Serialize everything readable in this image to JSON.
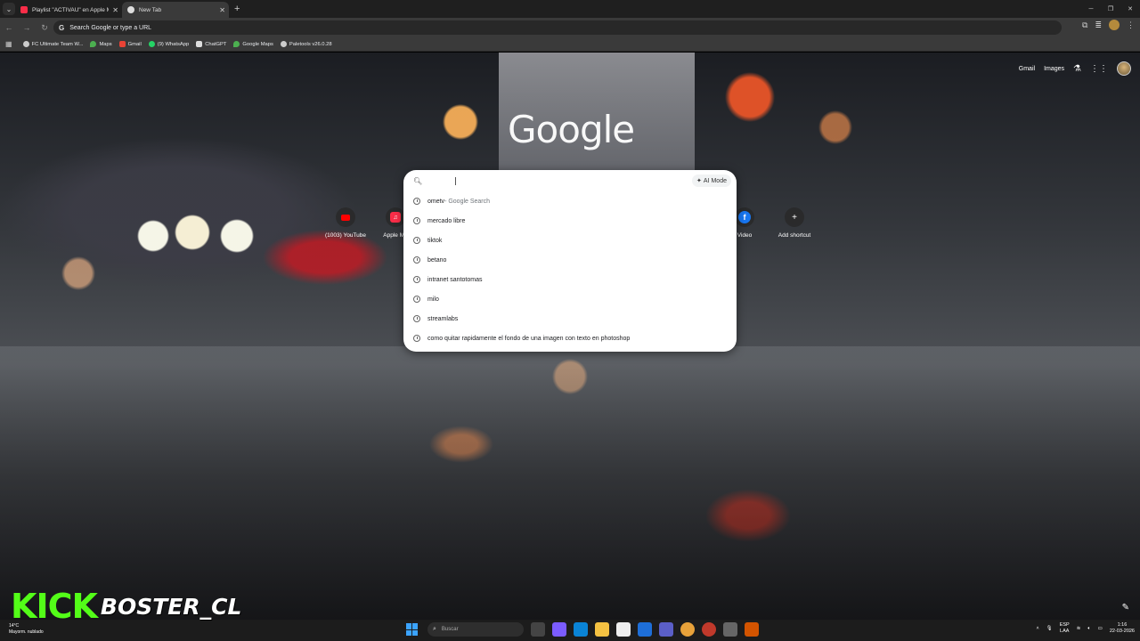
{
  "tabs": [
    {
      "title": "Playlist \"ACTIVAU\" en Apple Mu",
      "favicon": "apple-music-icon",
      "active": false
    },
    {
      "title": "New Tab",
      "favicon": "chrome-icon",
      "active": true
    }
  ],
  "toolbar": {
    "omnibox_placeholder": "Search Google or type a URL"
  },
  "bookmarks": [
    {
      "label": "FC Ultimate Team W...",
      "icon": "globe-icon"
    },
    {
      "label": "Maps",
      "icon": "maps-icon"
    },
    {
      "label": "Gmail",
      "icon": "gmail-icon"
    },
    {
      "label": "(9) WhatsApp",
      "icon": "whatsapp-icon"
    },
    {
      "label": "ChatGPT",
      "icon": "chatgpt-icon"
    },
    {
      "label": "Google Maps",
      "icon": "maps-icon"
    },
    {
      "label": "Paletools v26.0.28",
      "icon": "globe-icon"
    }
  ],
  "ntp": {
    "gmail_link": "Gmail",
    "images_link": "Images",
    "logo": "Google"
  },
  "shortcuts": [
    {
      "label": "(1003) YouTube",
      "icon": "youtube-icon"
    },
    {
      "label": "Apple Mu",
      "icon": "apple-music-icon"
    },
    {
      "label": "Video",
      "icon": "facebook-icon"
    },
    {
      "label": "Add shortcut",
      "icon": "plus-icon"
    }
  ],
  "search": {
    "ai_mode_label": "AI Mode",
    "suggestions": [
      {
        "text": "ometv",
        "extra": " - Google Search"
      },
      {
        "text": "mercado libre",
        "extra": ""
      },
      {
        "text": "tiktok",
        "extra": ""
      },
      {
        "text": "betano",
        "extra": ""
      },
      {
        "text": "intranet santotomas",
        "extra": ""
      },
      {
        "text": "milo",
        "extra": ""
      },
      {
        "text": "streamlabs",
        "extra": ""
      },
      {
        "text": "como quitar rapidamente el fondo de una imagen con texto en photoshop",
        "extra": ""
      }
    ]
  },
  "watermark": {
    "brand": "KICK",
    "channel": "BOSTER_CL"
  },
  "taskbar": {
    "temperature": "14°C",
    "weather": "Mayorm. nublado",
    "search_placeholder": "Buscar",
    "lang_top": "ESP",
    "lang_bottom": "LAA",
    "time": "1:16",
    "date": "22-03-2026"
  },
  "colors": {
    "kick_green": "#53fc18",
    "youtube_red": "#ff0000",
    "facebook_blue": "#1877f2",
    "apple_music_red": "#fa2d48"
  }
}
